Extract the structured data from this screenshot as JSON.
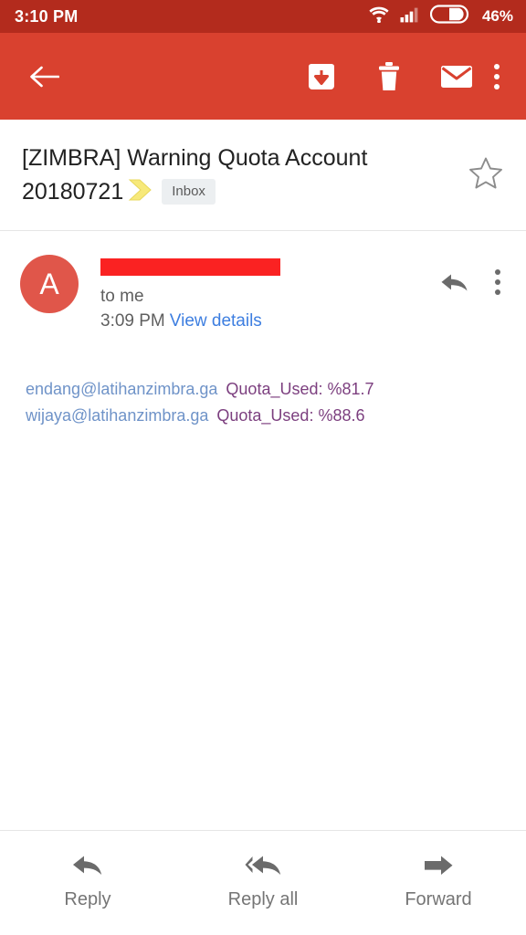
{
  "status_bar": {
    "clock": "3:10 PM",
    "battery_percent": "46%",
    "wifi_icon": "wifi-icon",
    "signal_icon": "cellular-signal-icon",
    "battery_icon": "battery-icon",
    "background_color": "#b32b1d"
  },
  "toolbar": {
    "background_color": "#d9412f",
    "back_label": "Back",
    "archive_label": "Move to",
    "delete_label": "Delete",
    "mark_unread_label": "Mark as unread",
    "overflow_label": "More options"
  },
  "subject": {
    "text": "[ZIMBRA] Warning Quota Account 20180721",
    "line1": "[ZIMBRA] Warning Quota Account",
    "line2": "20180721",
    "label_chip": "Inbox",
    "importance_marker_color": "#f5e56b",
    "starred": false,
    "star_label": "Star"
  },
  "message": {
    "avatar_letter": "A",
    "avatar_color": "#e0564a",
    "sender_name_redacted": true,
    "recipient": "to me",
    "time": "3:09 PM",
    "view_details": "View details",
    "reply_icon_label": "Reply",
    "overflow_label": "More options"
  },
  "body": {
    "lines": [
      {
        "address": "endang@latihanzimbra.ga",
        "quota": "Quota_Used: %81.7"
      },
      {
        "address": "wijaya@latihanzimbra.ga",
        "quota": "Quota_Used: %88.6"
      }
    ],
    "address_color": "#6f93c8",
    "quota_color": "#7c3f7f"
  },
  "action_bar": {
    "items": [
      {
        "label": "Reply",
        "icon": "reply-arrow-icon"
      },
      {
        "label": "Reply all",
        "icon": "reply-all-arrow-icon"
      },
      {
        "label": "Forward",
        "icon": "forward-arrow-icon"
      }
    ]
  }
}
